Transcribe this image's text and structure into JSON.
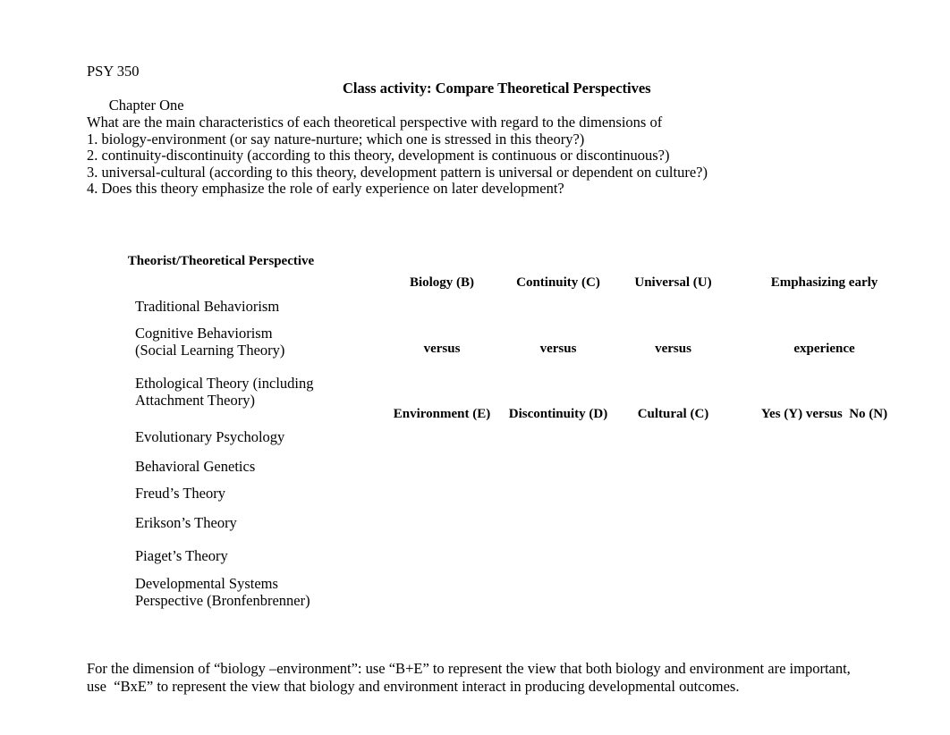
{
  "document": {
    "course_code": "PSY 350",
    "chapter": "Chapter One",
    "title": "Class activity: Compare Theoretical Perspectives"
  },
  "intro": {
    "lead": "What are the main characteristics of each theoretical perspective with regard to the dimensions of",
    "items": [
      "1. biology-environment (or say nature-nurture; which one is stressed in this theory?)",
      "2. continuity-discontinuity (according to this theory, development is continuous or discontinuous?)",
      "3. universal-cultural (according to this theory, development pattern is universal or dependent on culture?)",
      "4. Does this theory emphasize the role of early experience on later development?"
    ]
  },
  "table": {
    "headers": {
      "row_label": "Theorist/Theoretical Perspective",
      "col1": {
        "line1": "Biology (B)",
        "line2": "versus",
        "line3": "Environment (E)"
      },
      "col2": {
        "line1": "Continuity (C)",
        "line2": "versus",
        "line3": "Discontinuity (D)"
      },
      "col3": {
        "line1": "Universal (U)",
        "line2": "versus",
        "line3": "Cultural (C)"
      },
      "col4": {
        "line1": "Emphasizing early",
        "line2": "experience",
        "line3": "Yes (Y) versus  No (N)"
      }
    },
    "rows": [
      {
        "line1": "Traditional Behaviorism",
        "line2": ""
      },
      {
        "line1": "Cognitive Behaviorism",
        "line2": "(Social Learning Theory)"
      },
      {
        "line1": "Ethological Theory (including",
        "line2": "Attachment Theory)"
      },
      {
        "line1": "Evolutionary Psychology",
        "line2": ""
      },
      {
        "line1": "Behavioral Genetics",
        "line2": ""
      },
      {
        "line1": "Freud’s Theory",
        "line2": ""
      },
      {
        "line1": "Erikson’s Theory",
        "line2": ""
      },
      {
        "line1": "Piaget’s Theory",
        "line2": ""
      },
      {
        "line1": "Developmental Systems",
        "line2": "Perspective (Bronfenbrenner)"
      }
    ]
  },
  "footer": {
    "line1": "For the dimension of “biology –environment”: use “B+E” to represent the view that both biology and environment are important,",
    "line2": "use  “BxE” to represent the view that biology and environment interact in producing developmental outcomes."
  }
}
